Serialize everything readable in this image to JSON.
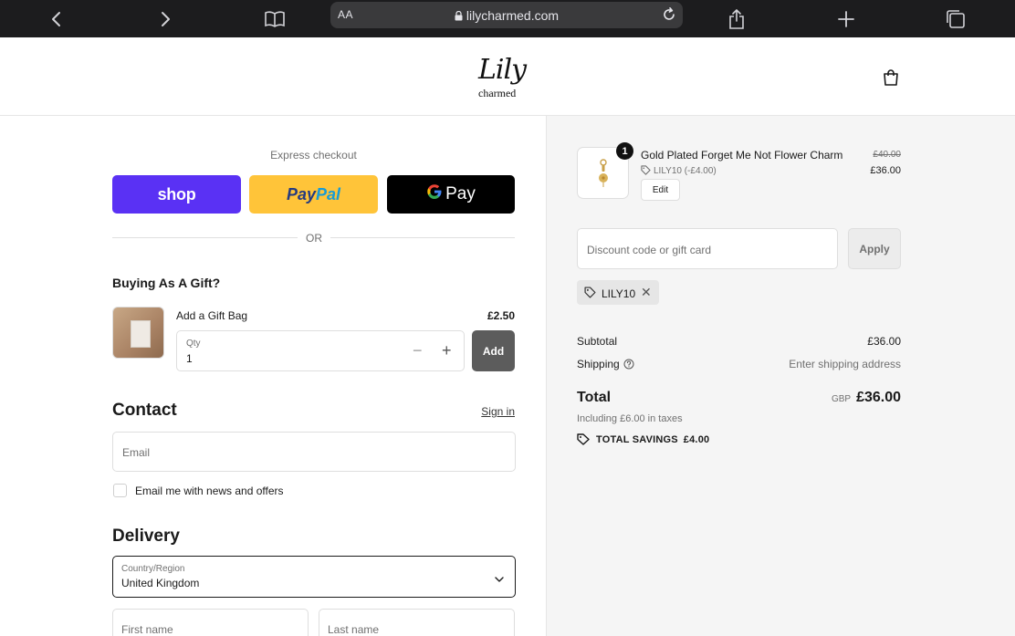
{
  "browser": {
    "text_size_label": "AA",
    "url": "lilycharmed.com"
  },
  "header": {
    "logo_script": "Lily",
    "logo_sub": "charmed"
  },
  "express": {
    "label": "Express checkout",
    "shop_label": "shop",
    "paypal_part1": "Pay",
    "paypal_part2": "Pal",
    "gpay_g": "G",
    "gpay_label": "Pay",
    "or_label": "OR"
  },
  "gift": {
    "title": "Buying As A Gift?",
    "item_name": "Add a Gift Bag",
    "price": "£2.50",
    "qty_label": "Qty",
    "qty_value": "1",
    "add_label": "Add"
  },
  "contact": {
    "heading": "Contact",
    "sign_in": "Sign in",
    "email_placeholder": "Email",
    "newsletter_label": "Email me with news and offers"
  },
  "delivery": {
    "heading": "Delivery",
    "country_label": "Country/Region",
    "country_value": "United Kingdom",
    "first_name_placeholder": "First name",
    "last_name_placeholder": "Last name"
  },
  "order": {
    "quantity_badge": "1",
    "item_name": "Gold Plated Forget Me Not Flower Charm",
    "item_discount": "LILY10 (-£4.00)",
    "edit_label": "Edit",
    "price_original": "£40.00",
    "price_current": "£36.00",
    "discount_placeholder": "Discount code or gift card",
    "apply_label": "Apply",
    "applied_code": "LILY10",
    "subtotal_label": "Subtotal",
    "subtotal_value": "£36.00",
    "shipping_label": "Shipping",
    "shipping_value": "Enter shipping address",
    "total_label": "Total",
    "currency": "GBP",
    "total_value": "£36.00",
    "taxes_note": "Including £6.00 in taxes",
    "savings_label": "TOTAL SAVINGS",
    "savings_value": "£4.00"
  },
  "colors": {
    "shop_purple": "#5a31f4",
    "paypal_yellow": "#ffc439",
    "gpay_black": "#000000",
    "add_button": "#5c5c5c",
    "summary_bg": "#f5f5f5"
  },
  "icons": [
    "back-icon",
    "forward-icon",
    "bookmarks-icon",
    "lock-icon",
    "reload-icon",
    "share-icon",
    "new-tab-icon",
    "tabs-icon",
    "cart-icon",
    "minus-icon",
    "plus-icon",
    "chevron-down-icon",
    "tag-icon",
    "close-icon",
    "help-icon"
  ]
}
